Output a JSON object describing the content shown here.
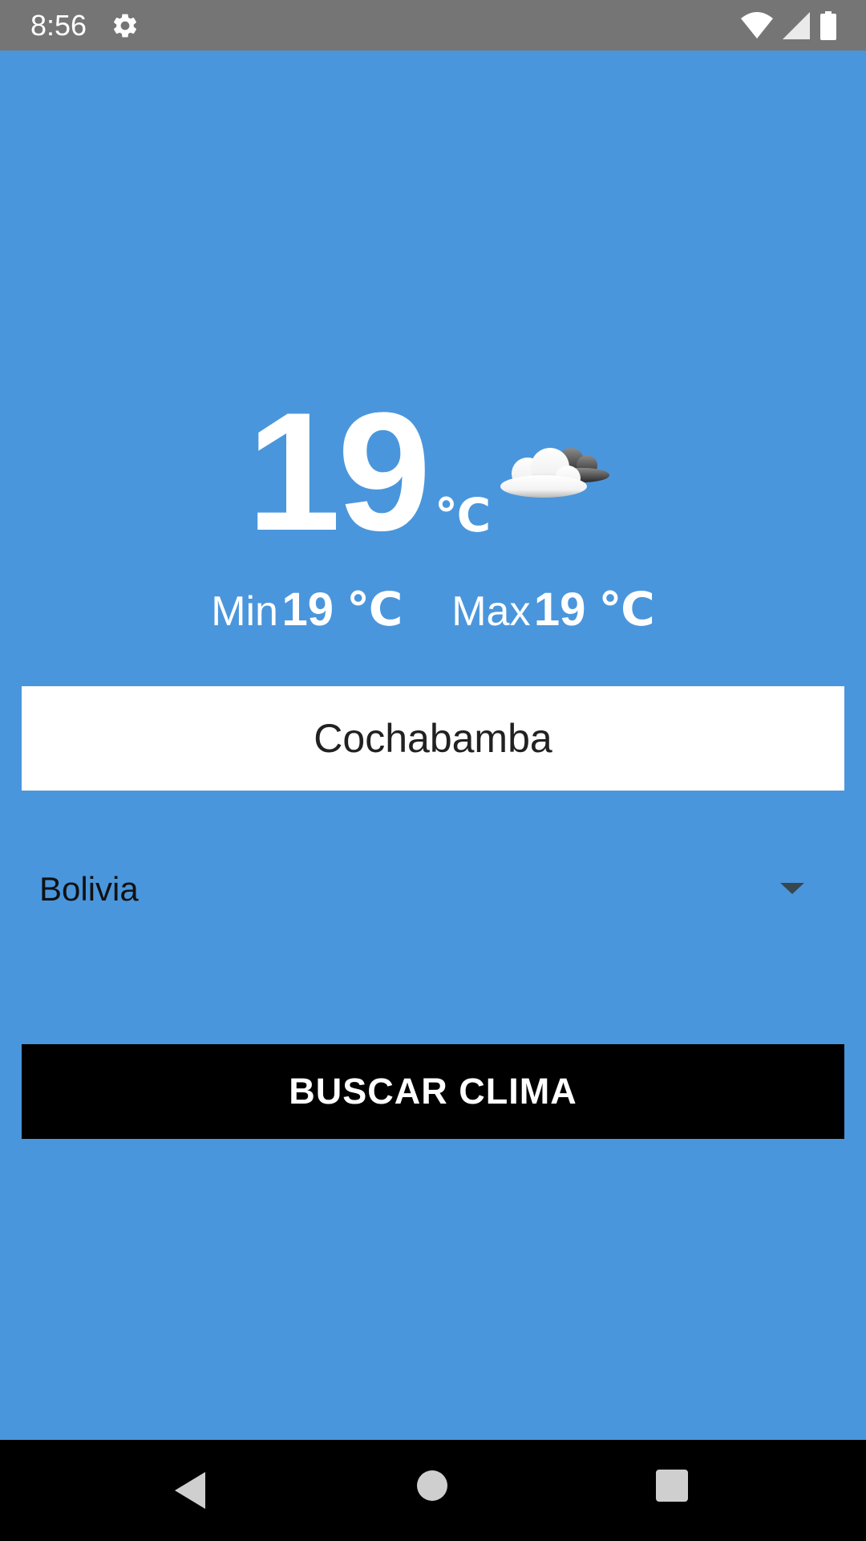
{
  "status_bar": {
    "time": "8:56",
    "icons": [
      "gear-icon",
      "wifi-icon",
      "signal-icon",
      "battery-icon"
    ]
  },
  "weather": {
    "temperature": "19",
    "unit": "℃",
    "icon": "cloudy-icon",
    "min_label": "Min",
    "min_value": "19 ℃",
    "max_label": "Max",
    "max_value": "19 ℃"
  },
  "form": {
    "city_value": "Cochabamba",
    "country_selected": "Bolivia",
    "search_button": "BUSCAR CLIMA"
  },
  "nav_bar": {
    "icons": [
      "back-icon",
      "home-icon",
      "recents-icon"
    ]
  },
  "colors": {
    "background": "#4a96dc",
    "status_bar": "#757575",
    "button": "#000000",
    "text_light": "#ffffff"
  }
}
